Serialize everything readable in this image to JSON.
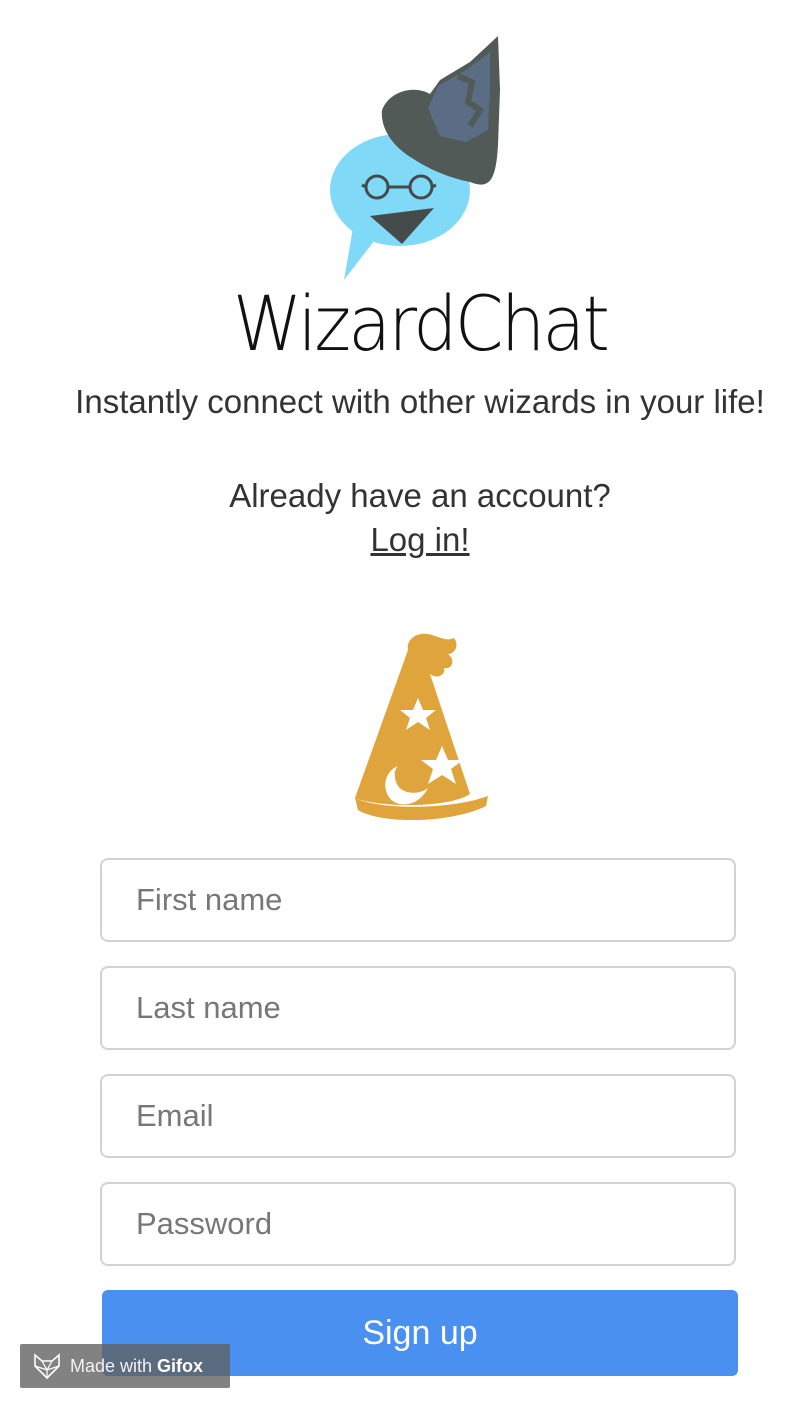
{
  "app": {
    "title": "WizardChat",
    "tagline": "Instantly connect with other wizards in your life!"
  },
  "logo": {
    "icon": "wizard-chat-bubble-icon",
    "colors": {
      "bubble": "#7fd9f7",
      "hat": "#525a58",
      "hat_accent": "#5a6d84",
      "mouth": "#454b4b"
    }
  },
  "login_prompt": {
    "text": "Already have an account?",
    "link_label": "Log in!"
  },
  "hat": {
    "icon": "wizard-hat-icon",
    "color": "#e0a43c"
  },
  "form": {
    "first_name_placeholder": "First name",
    "last_name_placeholder": "Last name",
    "email_placeholder": "Email",
    "password_placeholder": "Password",
    "submit_label": "Sign up",
    "submit_color": "#4a90f0"
  },
  "watermark": {
    "made_with": "Made with",
    "brand": "Gifox",
    "icon": "fox-icon"
  }
}
